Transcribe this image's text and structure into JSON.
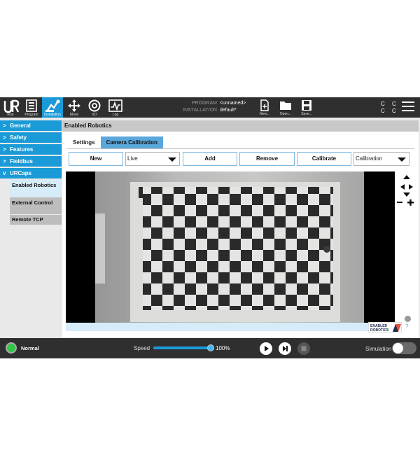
{
  "colors": {
    "accent": "#1a9ad7",
    "topbar": "#2f2f2f",
    "status_ok": "#33c74a"
  },
  "topbar": {
    "nav": [
      {
        "label": "Run",
        "icon": "run-icon"
      },
      {
        "label": "Program",
        "icon": "program-icon"
      },
      {
        "label": "Installation",
        "icon": "installation-icon",
        "active": true
      },
      {
        "label": "Move",
        "icon": "move-icon"
      },
      {
        "label": "I/O",
        "icon": "io-icon"
      },
      {
        "label": "Log",
        "icon": "log-icon"
      }
    ],
    "program_key": "PROGRAM",
    "program_value": "<unnamed>",
    "installation_key": "INSTALLATION",
    "installation_value": "default*",
    "file_buttons": [
      {
        "label": "New...",
        "icon": "new-file-icon"
      },
      {
        "label": "Open...",
        "icon": "open-folder-icon"
      },
      {
        "label": "Save...",
        "icon": "save-icon"
      }
    ],
    "cc_top": "C C",
    "cc_bottom": "C C"
  },
  "sidebar": {
    "groups": [
      {
        "label": "General",
        "chevron": ">"
      },
      {
        "label": "Safety",
        "chevron": ">"
      },
      {
        "label": "Features",
        "chevron": ">"
      },
      {
        "label": "Fieldbus",
        "chevron": ">"
      },
      {
        "label": "URCaps",
        "chevron": "v"
      }
    ],
    "urcaps_items": [
      {
        "label": "Enabled Robotics",
        "state": "active"
      },
      {
        "label": "External Control",
        "state": "inactive"
      },
      {
        "label": "Remote TCP",
        "state": "inactive"
      }
    ]
  },
  "content": {
    "title": "Enabled Robotics",
    "tabs": [
      {
        "label": "Settings",
        "active": false
      },
      {
        "label": "Camera Calibration",
        "active": true
      }
    ],
    "toolbar": {
      "new_label": "New",
      "source_select": "Live",
      "add_label": "Add",
      "remove_label": "Remove",
      "calibrate_label": "Calibrate",
      "mode_select": "Calibration"
    },
    "help": "?"
  },
  "bottombar": {
    "status": "Normal",
    "speed_label": "Speed",
    "speed_value": "100%",
    "speed_fraction": 1.0,
    "simulation_label": "Simulation"
  }
}
